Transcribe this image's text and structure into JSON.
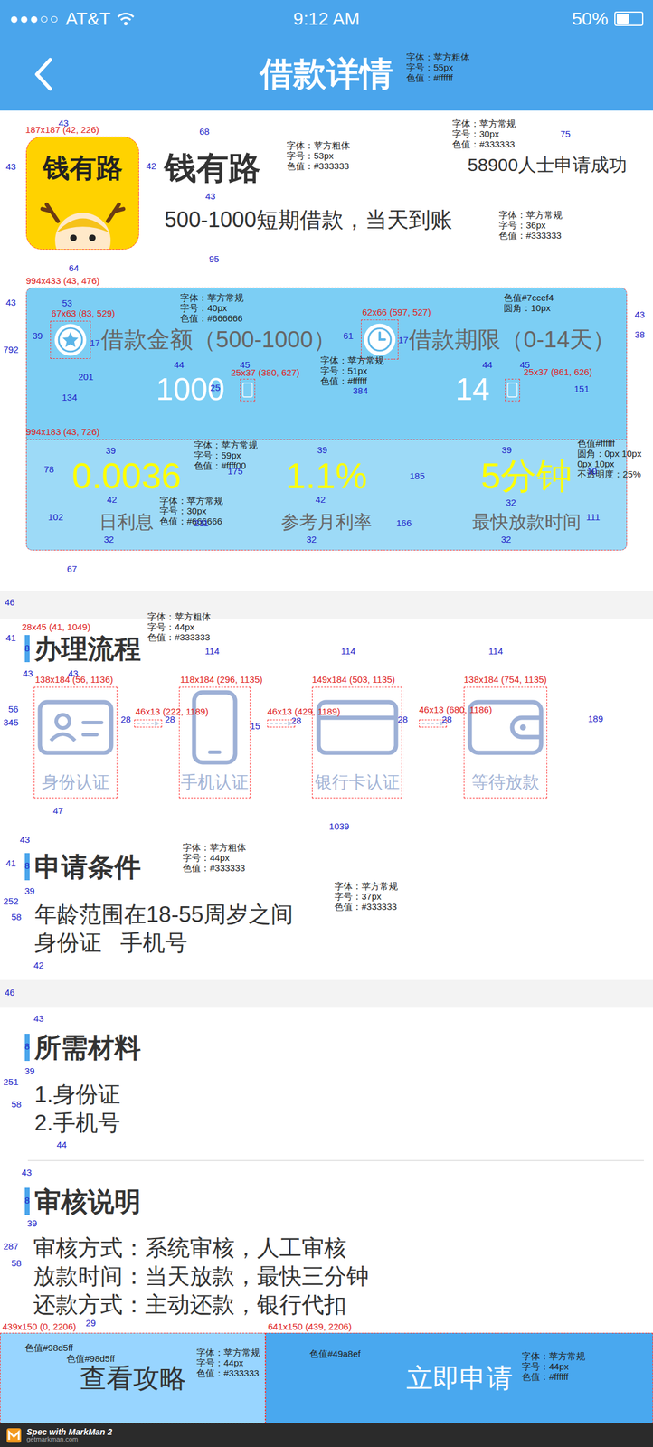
{
  "status_bar": {
    "signal": "●●●○○",
    "carrier": "AT&T",
    "time": "9:12 AM",
    "battery": "50%",
    "battery_level": 0.5
  },
  "nav": {
    "title": "借款详情"
  },
  "product": {
    "logo_text": "钱有路",
    "name": "钱有路",
    "applicants": "58900人士申请成功",
    "tagline": "500-1000短期借款，当天到账"
  },
  "loan": [
    {
      "kind": "amount",
      "label": "借款金额（500-1000）",
      "value": "1000"
    },
    {
      "kind": "term",
      "label": "借款期限（0-14天）",
      "value": "14"
    }
  ],
  "rates": [
    {
      "value": "0.0036",
      "label": "日利息"
    },
    {
      "value": "1.1%",
      "label": "参考月利率"
    },
    {
      "value": "5分钟",
      "label": "最快放款时间"
    }
  ],
  "process": {
    "title": "办理流程",
    "steps": [
      {
        "kind": "id",
        "label": "身份认证"
      },
      {
        "kind": "phone",
        "label": "手机认证"
      },
      {
        "kind": "card",
        "label": "银行卡认证"
      },
      {
        "kind": "wallet",
        "label": "等待放款"
      }
    ]
  },
  "conditions": {
    "title": "申请条件",
    "lines": [
      "年龄范围在18-55周岁之间",
      "身份证   手机号"
    ]
  },
  "materials": {
    "title": "所需材料",
    "items": [
      "1.身份证",
      "2.手机号"
    ]
  },
  "review": {
    "title": "审核说明",
    "lines": [
      "审核方式：系统审核，人工审核",
      "放款时间：当天放款，最快三分钟",
      "还款方式：主动还款，银行代扣"
    ]
  },
  "buttons": [
    {
      "label": "查看攻略",
      "kind": "secondary"
    },
    {
      "label": "立即申请",
      "kind": "primary"
    }
  ],
  "footer": {
    "brand": "Spec with MarkMan 2",
    "site": "getmarkman.com"
  },
  "annotations": {
    "notes": [
      {
        "lines": [
          "字体：苹方粗体",
          "字号：55px",
          "色值：#ffffff"
        ]
      },
      {
        "lines": [
          "字体：苹方常规",
          "字号：30px",
          "色值：#333333"
        ]
      },
      {
        "lines": [
          "字体：苹方粗体",
          "字号：53px",
          "色值：#333333"
        ]
      },
      {
        "lines": [
          "字体：苹方常规",
          "字号：36px",
          "色值：#333333"
        ]
      },
      {
        "lines": [
          "字体：苹方常规",
          "字号：40px",
          "色值：#666666"
        ]
      },
      {
        "lines": [
          "色值#7ccef4",
          "圆角：10px"
        ]
      },
      {
        "lines": [
          "字体：苹方常规",
          "字号：51px",
          "色值：#ffffff"
        ]
      },
      {
        "lines": [
          "字体：苹方常规",
          "字号：59px",
          "色值：#ffff00"
        ]
      },
      {
        "lines": [
          "色值#ffffff",
          "圆角：0px 10px",
          "0px 10px",
          "不透明度：25%"
        ]
      },
      {
        "lines": [
          "字体：苹方常规",
          "字号：30px",
          "色值：#666666"
        ]
      },
      {
        "lines": [
          "字体：苹方粗体",
          "字号：44px",
          "色值：#333333"
        ]
      },
      {
        "lines": [
          "字体：苹方粗体",
          "字号：44px",
          "色值：#333333"
        ]
      },
      {
        "lines": [
          "字体：苹方常规",
          "字号：37px",
          "色值：#333333"
        ]
      },
      {
        "lines": [
          "色值#98d5ff"
        ]
      },
      {
        "lines": [
          "色值#98d5ff"
        ]
      },
      {
        "lines": [
          "字体：苹方常规",
          "字号：44px",
          "色值：#333333"
        ]
      },
      {
        "lines": [
          "色值#49a8ef"
        ]
      },
      {
        "lines": [
          "字体：苹方常规",
          "字号：44px",
          "色值：#ffffff"
        ]
      }
    ],
    "boxes": [
      "187x187 (42, 226)",
      "994x433 (43, 476)",
      "67x63 (83, 529)",
      "62x66 (597, 527)",
      "25x37 (380, 627)",
      "25x37 (861, 626)",
      "994x183 (43, 726)",
      "28x45 (41, 1049)",
      "138x184 (56, 1136)",
      "118x184 (296, 1135)",
      "149x184 (503, 1135)",
      "138x184 (754, 1135)",
      "46x13 (222, 1189)",
      "46x13 (429, 1189)",
      "46x13 (680, 1186)",
      "439x150 (0, 2206)",
      "641x150 (439, 2206)"
    ],
    "dimensions": [
      "43",
      "68",
      "75",
      "43",
      "42",
      "43",
      "64",
      "95",
      "43",
      "792",
      "53",
      "39",
      "17",
      "61",
      "17",
      "43",
      "38",
      "44",
      "45",
      "201",
      "134",
      "25",
      "384",
      "44",
      "45",
      "151",
      "39",
      "39",
      "39",
      "78",
      "175",
      "185",
      "10",
      "42",
      "42",
      "32",
      "102",
      "211",
      "166",
      "111",
      "32",
      "32",
      "32",
      "67",
      "46",
      "41",
      "8",
      "43",
      "43",
      "114",
      "114",
      "114",
      "56",
      "345",
      "28",
      "28",
      "15",
      "28",
      "28",
      "28",
      "189",
      "47",
      "1039",
      "43",
      "41",
      "8",
      "39",
      "252",
      "58",
      "42",
      "46",
      "43",
      "8",
      "39",
      "251",
      "58",
      "44",
      "43",
      "8",
      "39",
      "287",
      "58",
      "29"
    ]
  }
}
